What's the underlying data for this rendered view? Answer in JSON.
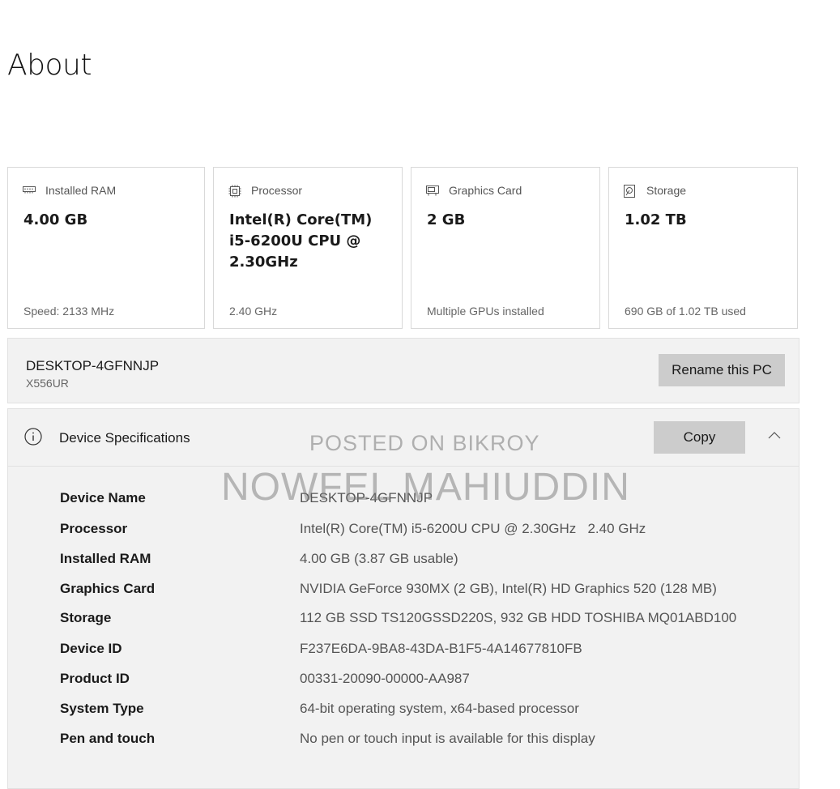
{
  "page": {
    "title": "About"
  },
  "cards": [
    {
      "icon": "ram-icon",
      "label": "Installed RAM",
      "value": "4.00 GB",
      "footer": "Speed: 2133 MHz"
    },
    {
      "icon": "processor-icon",
      "label": "Processor",
      "value": "Intel(R) Core(TM) i5-6200U CPU @ 2.30GHz",
      "footer": "2.40 GHz"
    },
    {
      "icon": "graphics-card-icon",
      "label": "Graphics Card",
      "value": "2 GB",
      "footer": "Multiple GPUs installed"
    },
    {
      "icon": "storage-icon",
      "label": "Storage",
      "value": "1.02 TB",
      "footer": "690 GB of 1.02 TB used"
    }
  ],
  "pc": {
    "name": "DESKTOP-4GFNNJP",
    "model": "X556UR",
    "rename_label": "Rename this PC"
  },
  "specs": {
    "title": "Device Specifications",
    "copy_label": "Copy",
    "rows": [
      {
        "label": "Device Name",
        "value": "DESKTOP-4GFNNJP"
      },
      {
        "label": "Processor",
        "value": "Intel(R) Core(TM) i5-6200U CPU @ 2.30GHz   2.40 GHz"
      },
      {
        "label": "Installed RAM",
        "value": "4.00 GB (3.87 GB usable)"
      },
      {
        "label": "Graphics Card",
        "value": "NVIDIA GeForce 930MX (2 GB), Intel(R) HD Graphics 520 (128 MB)"
      },
      {
        "label": "Storage",
        "value": "112 GB SSD TS120GSSD220S, 932 GB HDD TOSHIBA MQ01ABD100"
      },
      {
        "label": "Device ID",
        "value": "F237E6DA-9BA8-43DA-B1F5-4A14677810FB"
      },
      {
        "label": "Product ID",
        "value": "00331-20090-00000-AA987"
      },
      {
        "label": "System Type",
        "value": "64-bit operating system, x64-based processor"
      },
      {
        "label": "Pen and touch",
        "value": "No pen or touch input is available for this display"
      }
    ]
  },
  "watermark": {
    "line1": "POSTED ON BIKROY",
    "line2": "NOWFEL MAHIUDDIN"
  }
}
